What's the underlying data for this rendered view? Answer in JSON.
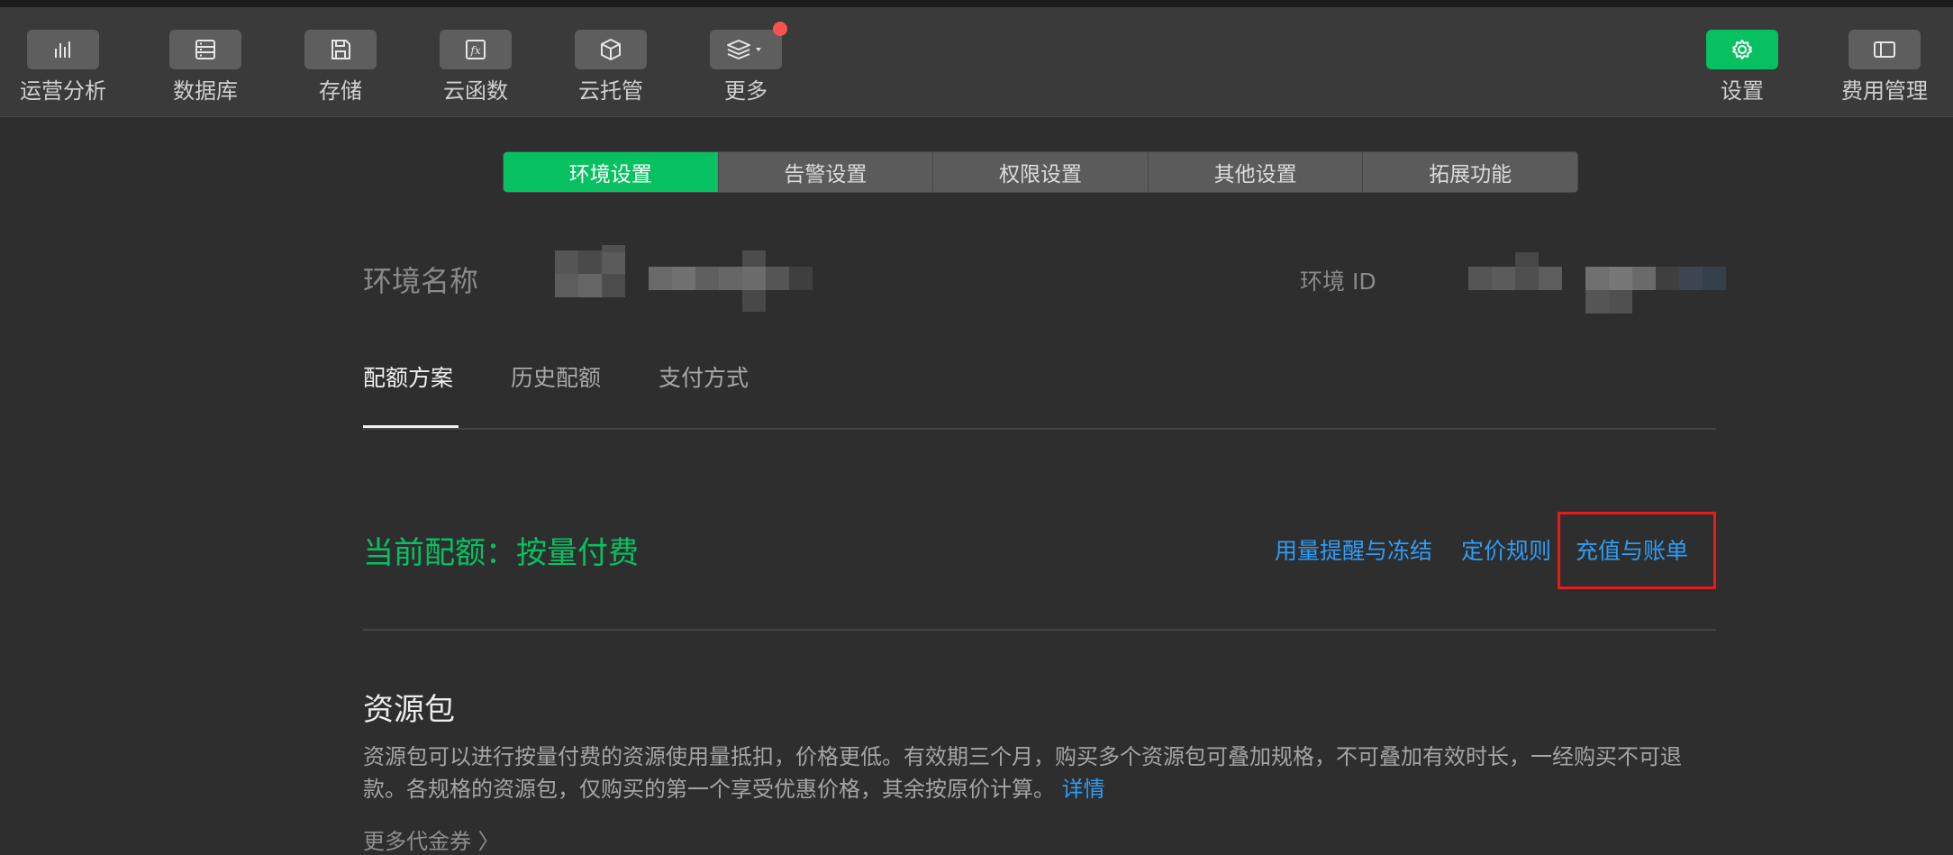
{
  "toolbar": {
    "items": [
      {
        "label": "运营分析",
        "icon": "bar-chart-icon"
      },
      {
        "label": "数据库",
        "icon": "database-icon"
      },
      {
        "label": "存储",
        "icon": "save-icon"
      },
      {
        "label": "云函数",
        "icon": "function-icon"
      },
      {
        "label": "云托管",
        "icon": "cube-icon"
      },
      {
        "label": "更多",
        "icon": "layers-icon"
      }
    ],
    "settings_label": "设置",
    "billing_label": "费用管理"
  },
  "tabs": [
    "环境设置",
    "告警设置",
    "权限设置",
    "其他设置",
    "拓展功能"
  ],
  "env": {
    "name_label": "环境名称",
    "id_label": "环境 ID"
  },
  "subtabs": [
    "配额方案",
    "历史配额",
    "支付方式"
  ],
  "quota": {
    "current": "当前配额：按量付费",
    "links": {
      "alert": "用量提醒与冻结",
      "pricing": "定价规则",
      "topup": "充值与账单"
    }
  },
  "resource": {
    "title": "资源包",
    "desc": "资源包可以进行按量付费的资源使用量抵扣，价格更低。有效期三个月，购买多个资源包可叠加规格，不可叠加有效时长，一经购买不可退款。各规格的资源包，仅购买的第一个享受优惠价格，其余按原价计算。",
    "detail_link": "详情",
    "more_coupons": "更多代金券 〉"
  },
  "colors": {
    "accent": "#07c160",
    "link": "#2f9cf5",
    "highlight": "#e81a1a",
    "badge": "#fa5151"
  }
}
